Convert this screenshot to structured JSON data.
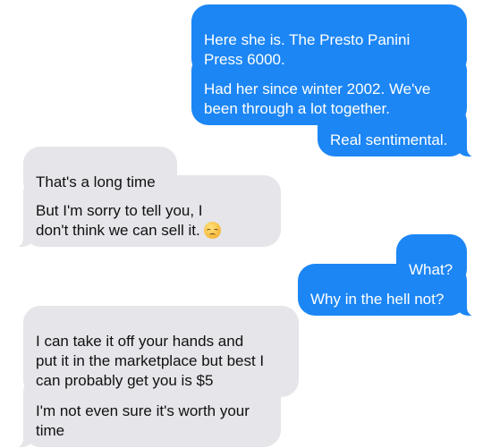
{
  "thread": {
    "messages": [
      {
        "from": "me",
        "text": "Here she is. The Presto Panini\nPress 6000."
      },
      {
        "from": "me",
        "text": "Had her since winter 2002. We've\nbeen through a lot together."
      },
      {
        "from": "me",
        "text": "Real sentimental."
      },
      {
        "from": "them",
        "text": "That's a long time"
      },
      {
        "from": "them",
        "text": "But I'm sorry to tell you, I\ndon't think we can sell it.",
        "emoji": "disappointed-face"
      },
      {
        "from": "me",
        "text": "What?"
      },
      {
        "from": "me",
        "text": "Why in the hell not?"
      },
      {
        "from": "them",
        "text": "I can take it off your hands and\nput it in the marketplace but best I\ncan probably get you is $5"
      },
      {
        "from": "them",
        "text": "I'm not even sure it's worth your\ntime"
      }
    ]
  },
  "colors": {
    "outgoing_bubble": "#1c86f5",
    "incoming_bubble": "#e5e5ea",
    "background": "#ffffff"
  }
}
